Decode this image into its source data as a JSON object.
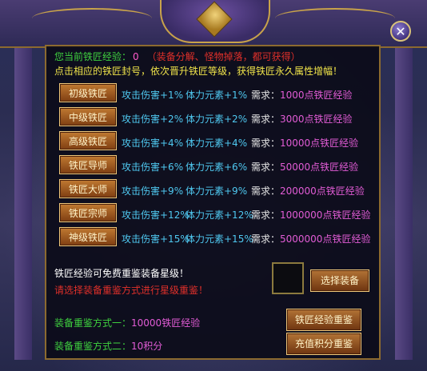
{
  "close_label": "✕",
  "info": {
    "exp_label": "您当前铁匠经验：",
    "exp_value": "0",
    "exp_hint": "（装备分解、怪物掉落，都可获得）",
    "desc": "点击相应的铁匠封号，依次晋升铁匠等级，获得铁匠永久属性增幅！"
  },
  "ranks": [
    {
      "name": "初级铁匠",
      "attack": "攻击伤害+1%",
      "stamina": "体力元素+1%",
      "req_label": "需求：",
      "req_value": "1000点铁匠经验"
    },
    {
      "name": "中级铁匠",
      "attack": "攻击伤害+2%",
      "stamina": "体力元素+2%",
      "req_label": "需求：",
      "req_value": "3000点铁匠经验"
    },
    {
      "name": "高级铁匠",
      "attack": "攻击伤害+4%",
      "stamina": "体力元素+4%",
      "req_label": "需求：",
      "req_value": "10000点铁匠经验"
    },
    {
      "name": "铁匠导师",
      "attack": "攻击伤害+6%",
      "stamina": "体力元素+6%",
      "req_label": "需求：",
      "req_value": "50000点铁匠经验"
    },
    {
      "name": "铁匠大师",
      "attack": "攻击伤害+9%",
      "stamina": "体力元素+9%",
      "req_label": "需求：",
      "req_value": "200000点铁匠经验"
    },
    {
      "name": "铁匠宗师",
      "attack": "攻击伤害+12%",
      "stamina": "体力元素+12%",
      "req_label": "需求：",
      "req_value": "1000000点铁匠经验"
    },
    {
      "name": "神级铁匠",
      "attack": "攻击伤害+15%",
      "stamina": "体力元素+15%",
      "req_label": "需求：",
      "req_value": "5000000点铁匠经验"
    }
  ],
  "appraise": {
    "text": "铁匠经验可免费重鉴装备星级！",
    "warn": "请选择装备重鉴方式进行星级重鉴！",
    "select_btn": "选择装备",
    "method1_label": "装备重鉴方式一：",
    "method1_value": "10000铁匠经验",
    "method1_btn": "铁匠经验重鉴",
    "method2_label": "装备重鉴方式二：",
    "method2_value": "10积分",
    "method2_btn": "充值积分重鉴"
  }
}
